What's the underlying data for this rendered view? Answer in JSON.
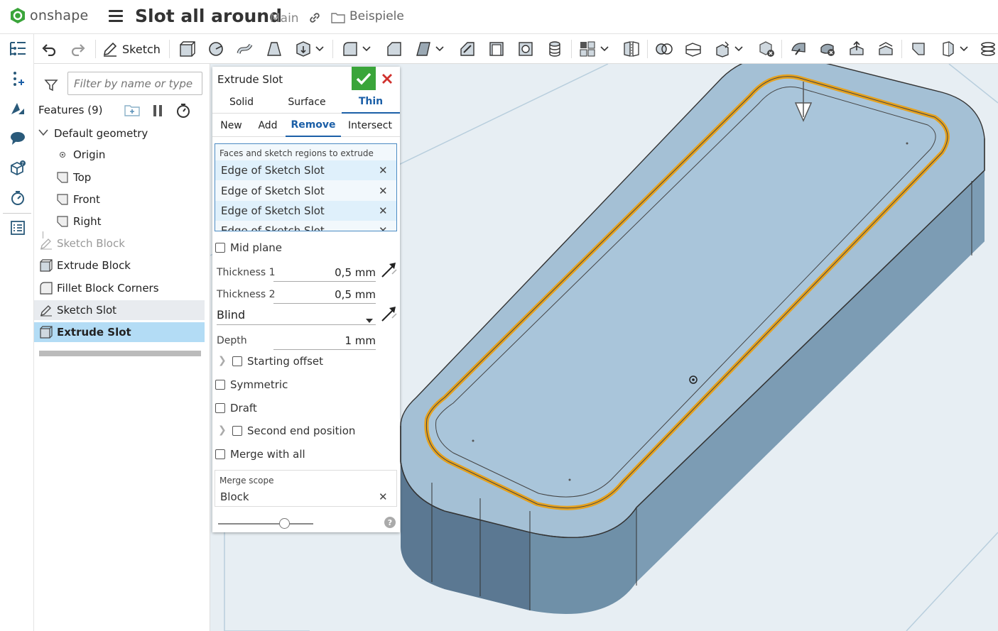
{
  "app": {
    "name": "onshape"
  },
  "document": {
    "title": "Slot all around",
    "workspace": "Main",
    "folder": "Beispiele"
  },
  "toolbar": {
    "sketch_label": "Sketch"
  },
  "feature_tree": {
    "filter_placeholder": "Filter by name or type",
    "header": "Features (9)",
    "default_geometry": "Default geometry",
    "items": [
      {
        "label": "Origin"
      },
      {
        "label": "Top"
      },
      {
        "label": "Front"
      },
      {
        "label": "Right"
      },
      {
        "label": "Sketch Block"
      },
      {
        "label": "Extrude Block"
      },
      {
        "label": "Fillet Block Corners"
      },
      {
        "label": "Sketch Slot"
      },
      {
        "label": "Extrude Slot"
      }
    ]
  },
  "dialog": {
    "title": "Extrude Slot",
    "body_tabs": [
      "Solid",
      "Surface",
      "Thin"
    ],
    "active_body_tab": "Thin",
    "op_tabs": [
      "New",
      "Add",
      "Remove",
      "Intersect"
    ],
    "active_op_tab": "Remove",
    "selection_header": "Faces and sketch regions to extrude",
    "selections": [
      "Edge of Sketch Slot",
      "Edge of Sketch Slot",
      "Edge of Sketch Slot",
      "Edge of Sketch Slot"
    ],
    "mid_plane": "Mid plane",
    "thickness1_label": "Thickness 1",
    "thickness1_value": "0,5 mm",
    "thickness2_label": "Thickness 2",
    "thickness2_value": "0,5 mm",
    "end_type": "Blind",
    "depth_label": "Depth",
    "depth_value": "1 mm",
    "starting_offset": "Starting offset",
    "symmetric": "Symmetric",
    "draft": "Draft",
    "second_end": "Second end position",
    "merge_with_all": "Merge with all",
    "merge_scope_header": "Merge scope",
    "merge_scope_value": "Block",
    "help": "?"
  },
  "colors": {
    "accent": "#1b5fa7",
    "ok": "#3aa53a",
    "cancel": "#d0312d",
    "selection": "#b3dcf5",
    "highlight_edge": "#e6a21e",
    "model": "#8fb0c8"
  }
}
